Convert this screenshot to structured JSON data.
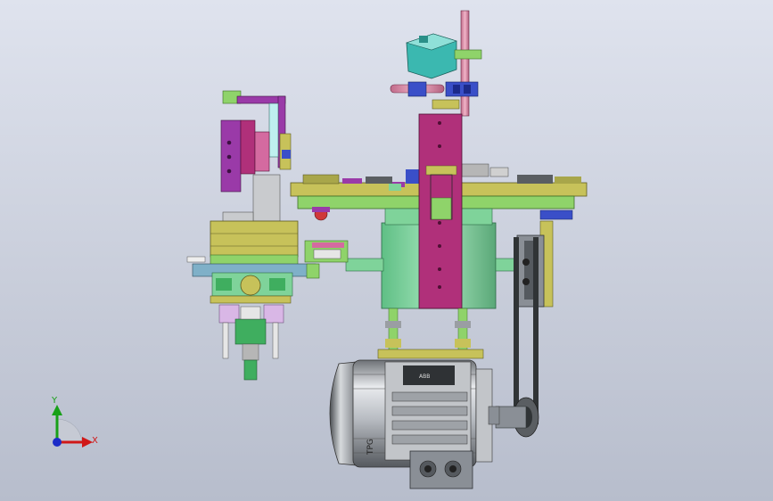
{
  "viewport": {
    "background_top": "#dfe3ee",
    "background_bottom": "#b7bdcc"
  },
  "triad": {
    "x_label": "X",
    "y_label": "Y",
    "x_color": "#d01818",
    "y_color": "#18a018",
    "z_color": "#1c2cc8"
  },
  "motor": {
    "nameplate_text": "TPG",
    "plate_text": "ABB"
  },
  "colors": {
    "magenta": "#b0307a",
    "olive": "#c7c25a",
    "green_light": "#8fd36a",
    "mint": "#7fd39a",
    "purple": "#9a3aa8",
    "teal": "#3bb8b0",
    "blue": "#3a4fc8",
    "pink": "#e08aa6",
    "grey_metal": "#8a8f96",
    "dark": "#303436"
  }
}
